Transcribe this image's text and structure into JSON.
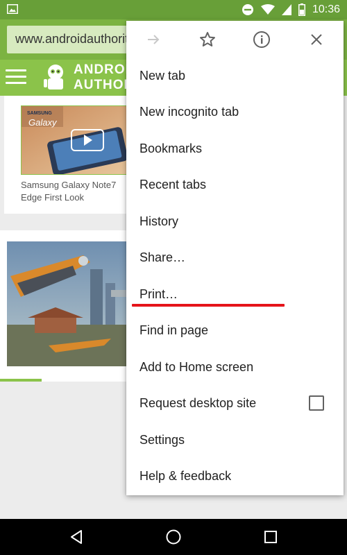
{
  "status_bar": {
    "time": "10:36",
    "icons": [
      "image-icon",
      "do-not-disturb-icon",
      "wifi-icon",
      "cell-signal-icon",
      "battery-icon"
    ]
  },
  "toolbar": {
    "url": "www.androidauthority.com"
  },
  "site": {
    "logo_line1": "ANDROID",
    "logo_line2": "AUTHORITY",
    "article1_caption_line1": "Samsung Galaxy Note7",
    "article1_caption_line2": "Edge First Look",
    "thumb_brand1": "SAMSUNG",
    "thumb_brand2": "Galaxy"
  },
  "menu": {
    "top_icons": [
      "forward-icon",
      "bookmark-star-icon",
      "info-icon",
      "close-icon"
    ],
    "items": [
      {
        "label": "New tab"
      },
      {
        "label": "New incognito tab"
      },
      {
        "label": "Bookmarks"
      },
      {
        "label": "Recent tabs"
      },
      {
        "label": "History"
      },
      {
        "label": "Share…"
      },
      {
        "label": "Print…"
      },
      {
        "label": "Find in page"
      },
      {
        "label": "Add to Home screen"
      },
      {
        "label": "Request desktop site",
        "checkbox": false
      },
      {
        "label": "Settings"
      },
      {
        "label": "Help & feedback"
      }
    ]
  },
  "colors": {
    "status_bar": "#689f38",
    "toolbar": "#7cb342",
    "site_header": "#8bc34a",
    "highlight_underline": "#e5141a"
  },
  "nav_bar": {
    "buttons": [
      "back-icon",
      "home-icon",
      "recents-icon"
    ]
  }
}
